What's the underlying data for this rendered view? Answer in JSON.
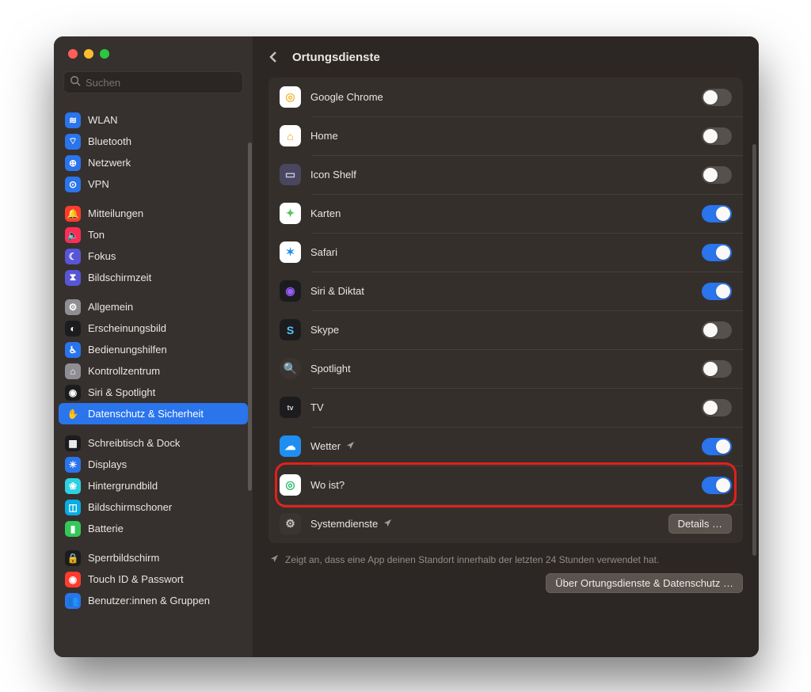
{
  "window": {
    "traffic": [
      "close",
      "minimize",
      "zoom"
    ]
  },
  "search": {
    "placeholder": "Suchen"
  },
  "sidebar": {
    "groups": [
      [
        {
          "label": "WLAN",
          "icon_bg": "#2a74ec",
          "glyph": "≋"
        },
        {
          "label": "Bluetooth",
          "icon_bg": "#2a74ec",
          "glyph": "⌔"
        },
        {
          "label": "Netzwerk",
          "icon_bg": "#2a74ec",
          "glyph": "⊕"
        },
        {
          "label": "VPN",
          "icon_bg": "#2a74ec",
          "glyph": "⊙"
        }
      ],
      [
        {
          "label": "Mitteilungen",
          "icon_bg": "#ff3b30",
          "glyph": "🔔"
        },
        {
          "label": "Ton",
          "icon_bg": "#ff2d55",
          "glyph": "🔈"
        },
        {
          "label": "Fokus",
          "icon_bg": "#5856d6",
          "glyph": "☾"
        },
        {
          "label": "Bildschirmzeit",
          "icon_bg": "#5856d6",
          "glyph": "⧗"
        }
      ],
      [
        {
          "label": "Allgemein",
          "icon_bg": "#8e8e93",
          "glyph": "⚙"
        },
        {
          "label": "Erscheinungsbild",
          "icon_bg": "#1c1c1e",
          "glyph": "◐"
        },
        {
          "label": "Bedienungshilfen",
          "icon_bg": "#2a74ec",
          "glyph": "♿︎"
        },
        {
          "label": "Kontrollzentrum",
          "icon_bg": "#8e8e93",
          "glyph": "⌂"
        },
        {
          "label": "Siri & Spotlight",
          "icon_bg": "#1c1c1e",
          "glyph": "◉"
        },
        {
          "label": "Datenschutz & Sicherheit",
          "icon_bg": "#2a74ec",
          "glyph": "✋",
          "selected": true
        }
      ],
      [
        {
          "label": "Schreibtisch & Dock",
          "icon_bg": "#1c1c1e",
          "glyph": "▦"
        },
        {
          "label": "Displays",
          "icon_bg": "#2a74ec",
          "glyph": "☀"
        },
        {
          "label": "Hintergrundbild",
          "icon_bg": "#2fd1e0",
          "glyph": "❀"
        },
        {
          "label": "Bildschirmschoner",
          "icon_bg": "#0aace3",
          "glyph": "◫"
        },
        {
          "label": "Batterie",
          "icon_bg": "#34c759",
          "glyph": "▮"
        }
      ],
      [
        {
          "label": "Sperrbildschirm",
          "icon_bg": "#1c1c1e",
          "glyph": "🔒"
        },
        {
          "label": "Touch ID & Passwort",
          "icon_bg": "#ff3b30",
          "glyph": "◉"
        },
        {
          "label": "Benutzer:innen & Gruppen",
          "icon_bg": "#2a74ec",
          "glyph": "👥"
        }
      ]
    ]
  },
  "header": {
    "title": "Ortungsdienste"
  },
  "apps": [
    {
      "name": "Google Chrome",
      "enabled": false,
      "icon_bg": "#ffffff",
      "glyph": "◎",
      "glyph_color": "#f6b73c"
    },
    {
      "name": "Home",
      "enabled": false,
      "icon_bg": "#ffffff",
      "glyph": "⌂",
      "glyph_color": "#ff9500"
    },
    {
      "name": "Icon Shelf",
      "enabled": false,
      "icon_bg": "#4a4660",
      "glyph": "▭",
      "glyph_color": "#c9c6e6"
    },
    {
      "name": "Karten",
      "enabled": true,
      "icon_bg": "#ffffff",
      "glyph": "✦",
      "glyph_color": "#5ac36a"
    },
    {
      "name": "Safari",
      "enabled": true,
      "icon_bg": "#ffffff",
      "glyph": "✶",
      "glyph_color": "#1f8ef1"
    },
    {
      "name": "Siri & Diktat",
      "enabled": true,
      "icon_bg": "#1c1c1e",
      "glyph": "◉",
      "glyph_color": "#9a5cff"
    },
    {
      "name": "Skype",
      "enabled": false,
      "icon_bg": "#1c1c1e",
      "glyph": "S",
      "glyph_color": "#55c6ff"
    },
    {
      "name": "Spotlight",
      "enabled": false,
      "icon_bg": "#3a3530",
      "glyph": "🔍",
      "glyph_color": "#d9d4cf",
      "round": true
    },
    {
      "name": "TV",
      "enabled": false,
      "icon_bg": "#1c1c1e",
      "glyph": "tv",
      "glyph_color": "#d9d4cf",
      "small": true
    },
    {
      "name": "Wetter",
      "enabled": true,
      "icon_bg": "#1f8ef1",
      "glyph": "☁",
      "glyph_color": "#ffffff",
      "has_arrow": true
    },
    {
      "name": "Wo ist?",
      "enabled": true,
      "icon_bg": "#ffffff",
      "glyph": "◎",
      "glyph_color": "#2bbd6e",
      "highlighted": true
    },
    {
      "name": "Systemdienste",
      "enabled": null,
      "icon_bg": "#3a3530",
      "glyph": "⚙",
      "glyph_color": "#c6c0b9",
      "has_arrow": true,
      "button": "Details …",
      "system": true
    }
  ],
  "footer": {
    "note": "Zeigt an, dass eine App deinen Standort innerhalb der letzten 24 Stunden verwendet hat.",
    "about_button": "Über Ortungsdienste & Datenschutz …"
  }
}
